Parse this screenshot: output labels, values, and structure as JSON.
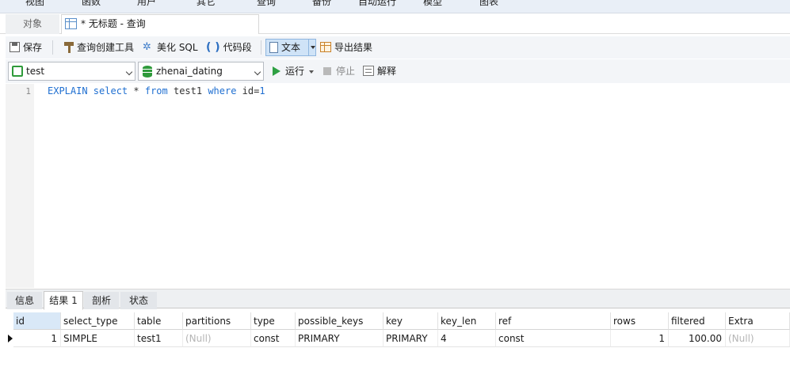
{
  "menu": {
    "items": [
      "视图",
      "函数",
      "用户",
      "其它",
      "查询",
      "备份",
      "自动运行",
      "模型",
      "图表"
    ]
  },
  "tabs": {
    "objects_label": "对象",
    "query_label": "* 无标题 - 查询"
  },
  "toolbar": {
    "save_label": "保存",
    "query_builder_label": "查询创建工具",
    "beautify_label": "美化 SQL",
    "code_snippet_label": "代码段",
    "text_label": "文本",
    "export_label": "导出结果"
  },
  "connection": {
    "connection_value": "test",
    "database_value": "zhenai_dating",
    "run_label": "运行",
    "stop_label": "停止",
    "explain_label": "解释"
  },
  "editor": {
    "line_number": "1",
    "tokens": {
      "t1": "EXPLAIN select",
      "t2": " * ",
      "t3": "from",
      "t4": " test1 ",
      "t5": "where",
      "t6": " id=",
      "t7": "1"
    }
  },
  "result_tabs": [
    "信息",
    "结果 1",
    "剖析",
    "状态"
  ],
  "grid": {
    "headers": [
      "id",
      "select_type",
      "table",
      "partitions",
      "type",
      "possible_keys",
      "key",
      "key_len",
      "ref",
      "rows",
      "filtered",
      "Extra"
    ],
    "row": [
      "1",
      "SIMPLE",
      "test1",
      "(Null)",
      "const",
      "PRIMARY",
      "PRIMARY",
      "4",
      "const",
      "1",
      "100.00",
      "(Null)"
    ]
  },
  "colors": {
    "accent": "#1f6fd1",
    "run_green": "#2ea043",
    "null_gray": "#b5b5b5",
    "selected_header": "#d9e8f7"
  }
}
